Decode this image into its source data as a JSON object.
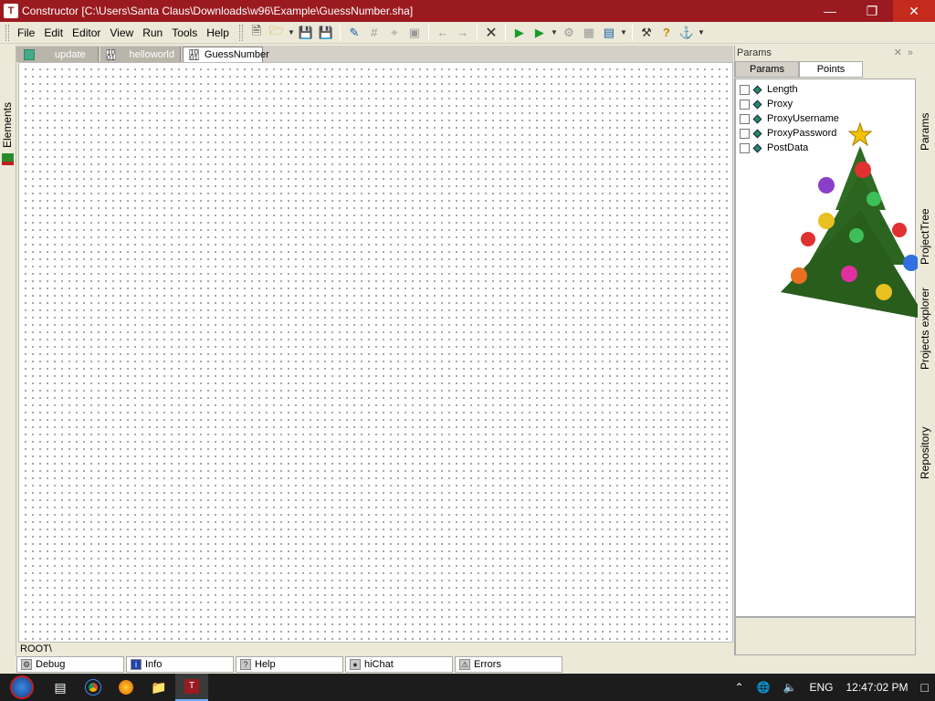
{
  "window": {
    "title": "Constructor [C:\\Users\\Santa Claus\\Downloads\\w96\\Example\\GuessNumber.sha]",
    "app_icon_letter": "T"
  },
  "menu": [
    "File",
    "Edit",
    "Editor",
    "View",
    "Run",
    "Tools",
    "Help"
  ],
  "tabs": [
    {
      "label": "update",
      "active": false
    },
    {
      "label": "helloworld",
      "active": false
    },
    {
      "label": "GuessNumber",
      "active": true
    }
  ],
  "left_sidebar": {
    "label": "Elements"
  },
  "path": "ROOT\\",
  "params_panel": {
    "title": "Params",
    "tabs": [
      {
        "label": "Params",
        "active": false
      },
      {
        "label": "Points",
        "active": true
      }
    ],
    "items": [
      "Length",
      "Proxy",
      "ProxyUsername",
      "ProxyPassword",
      "PostData"
    ]
  },
  "right_sidebar": [
    "Params",
    "ProjectTree",
    "Projects explorer",
    "Repository"
  ],
  "bottom_tabs": [
    "Debug",
    "Info",
    "Help",
    "hiChat",
    "Errors"
  ],
  "taskbar": {
    "lang": "ENG",
    "time": "12:47:02 PM"
  },
  "colors": {
    "title_bar": "#9b1a1f",
    "taskbar": "#1c1c1c",
    "accent_green": "#2a8a5a"
  }
}
